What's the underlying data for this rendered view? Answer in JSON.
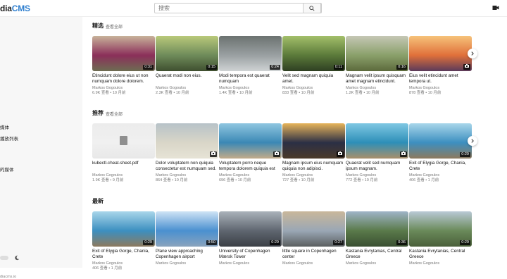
{
  "header": {
    "logo_part1": "dia",
    "logo_part2": "CMS",
    "search_placeholder": "搜索"
  },
  "sidebar": {
    "items": [
      "媒体",
      "播放列表",
      "的媒体"
    ],
    "footer": "diacms.io"
  },
  "sections": [
    {
      "title": "精选",
      "link": "查看全部",
      "cards": [
        {
          "title": "Etincidunt dolore eius ut non numquam dolore dolorem.",
          "author": "Markos Gogoulos",
          "meta": "6.9K 查看 • 10 月前",
          "badge": "0:31",
          "colors": [
            "#8b2f5a",
            "#c8b39a",
            "#6d6d52"
          ]
        },
        {
          "title": "Quaerat modi non eius.",
          "author": "Markos Gogoulos",
          "meta": "2.3K 查看 • 10 月前",
          "badge": "0:15",
          "colors": [
            "#6e8b5a",
            "#b9c97a",
            "#3f4f2f"
          ]
        },
        {
          "title": "Modi tempora est quaerat numquam",
          "author": "Markos Gogoulos",
          "meta": "1.4K 查看 • 10 月前",
          "badge": "0:24",
          "colors": [
            "#9aa0a2",
            "#6b7270",
            "#cfd3d4"
          ]
        },
        {
          "title": "Velit sed magnam quiquia amet.",
          "author": "Markos Gogoulos",
          "meta": "833 查看 • 10 月前",
          "badge": "0:11",
          "colors": [
            "#5b7a3a",
            "#a3bf6a",
            "#2e3f22"
          ]
        },
        {
          "title": "Magnam velit ipsum quisquam amet magnam etincidunt.",
          "author": "Markos Gogoulos",
          "meta": "1.2K 查看 • 10 月前",
          "badge": "0:16",
          "colors": [
            "#8aa06a",
            "#c5c7b5",
            "#5c6a3c"
          ]
        },
        {
          "title": "Eius velit etincidunt amet tempora ut.",
          "author": "Markos Gogoulos",
          "meta": "878 查看 • 10 月前",
          "badge": "camera",
          "colors": [
            "#e0703a",
            "#f6c27a",
            "#5a3a5a"
          ]
        }
      ]
    },
    {
      "title": "推荐",
      "link": "查看全部",
      "cards": [
        {
          "title": "kubectl-cheat-sheet.pdf",
          "author": "Markos Gogoulos",
          "meta": "1.9K 查看 • 9 月前",
          "badge": "pdf",
          "colors": [
            "#f0f0f0",
            "#ececec",
            "#e8e8e8"
          ]
        },
        {
          "title": "Dolor voluptatem non quiquia consectetur est numquam sed.",
          "author": "Markos Gogoulos",
          "meta": "864 查看 • 10 月前",
          "badge": "camera",
          "colors": [
            "#d9d6c8",
            "#b7c2c8",
            "#e6e3d6"
          ]
        },
        {
          "title": "Voluptatem porro neque tempora dolorem quiquia est dolor.",
          "author": "Markos Gogoulos",
          "meta": "696 查看 • 10 月前",
          "badge": "camera",
          "colors": [
            "#3b88b5",
            "#8fc6e0",
            "#c2ab8a"
          ]
        },
        {
          "title": "Magnam ipsum eius numquam quiquia non adipisci.",
          "author": "Markos Gogoulos",
          "meta": "727 查看 • 10 月前",
          "badge": "camera",
          "colors": [
            "#2b2f45",
            "#e6b45a",
            "#4b3a2a"
          ]
        },
        {
          "title": "Quaerat velit sed numquam ipsum magnam.",
          "author": "Markos Gogoulos",
          "meta": "772 查看 • 10 月前",
          "badge": "camera",
          "colors": [
            "#2d8fb8",
            "#7fc7e3",
            "#a88f6a"
          ]
        },
        {
          "title": "Exit of Elygia Gorge, Chania, Crete",
          "author": "Markos Gogoulos",
          "meta": "406 查看 • 1 月前",
          "badge": "0:29",
          "colors": [
            "#3c8fc0",
            "#a9d6ea",
            "#8d7a5e"
          ]
        }
      ]
    },
    {
      "title": "最新",
      "link": "",
      "cards": [
        {
          "title": "Exit of Elygia Gorge, Chania, Crete",
          "author": "Markos Gogoulos",
          "meta": "406 查看 • 1 月前",
          "badge": "0:29",
          "colors": [
            "#3c8fc0",
            "#a9d6ea",
            "#8d7a5e"
          ]
        },
        {
          "title": "Plane view approaching Copenhagen airport",
          "author": "Markos Gogoulos",
          "meta": "",
          "badge": "0:50",
          "colors": [
            "#4a90d0",
            "#cfe3f5",
            "#8aa3bd"
          ]
        },
        {
          "title": "University of Copenhagen Mærsk Tower",
          "author": "Markos Gogoulos",
          "meta": "",
          "badge": "0:29",
          "colors": [
            "#5f6670",
            "#aab2ba",
            "#3b3f45"
          ]
        },
        {
          "title": "little square in Copenhagen center",
          "author": "Markos Gogoulos",
          "meta": "",
          "badge": "0:27",
          "colors": [
            "#9aa7b5",
            "#c9b79a",
            "#5b5f60"
          ]
        },
        {
          "title": "Kastania Evrytanias, Central Greece",
          "author": "Markos Gogoulos",
          "meta": "",
          "badge": "0:36",
          "colors": [
            "#5a7a4a",
            "#9fb4c8",
            "#3a4f32"
          ]
        },
        {
          "title": "Kastania Evrytanias, Central Greece",
          "author": "Markos Gogoulos",
          "meta": "",
          "badge": "0:29",
          "colors": [
            "#6a8a5a",
            "#b9c9d6",
            "#4a5f3a"
          ]
        }
      ]
    }
  ]
}
